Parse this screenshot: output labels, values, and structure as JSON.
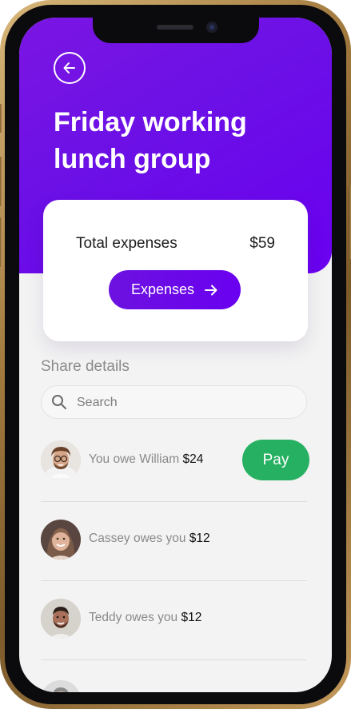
{
  "header": {
    "title": "Friday working lunch group",
    "back_icon": "arrow-left-icon",
    "gradient_start": "#7b16e3",
    "gradient_end": "#6a00f0"
  },
  "summary": {
    "total_label": "Total expenses",
    "total_value": "$59",
    "expenses_button_label": "Expenses",
    "expenses_button_icon": "arrow-right-icon"
  },
  "share": {
    "section_title": "Share details",
    "search_placeholder": "Search",
    "search_value": "",
    "rows": [
      {
        "text": "You owe William",
        "amount": "$24",
        "action": "Pay",
        "avatar_icon": "avatar-william"
      },
      {
        "text": "Cassey owes you",
        "amount": "$12",
        "avatar_icon": "avatar-cassey"
      },
      {
        "text": "Teddy owes you",
        "amount": "$12",
        "avatar_icon": "avatar-teddy"
      }
    ]
  },
  "colors": {
    "accent": "#6a00f0",
    "pay_green": "#26b061",
    "background": "#f3f3f3"
  }
}
